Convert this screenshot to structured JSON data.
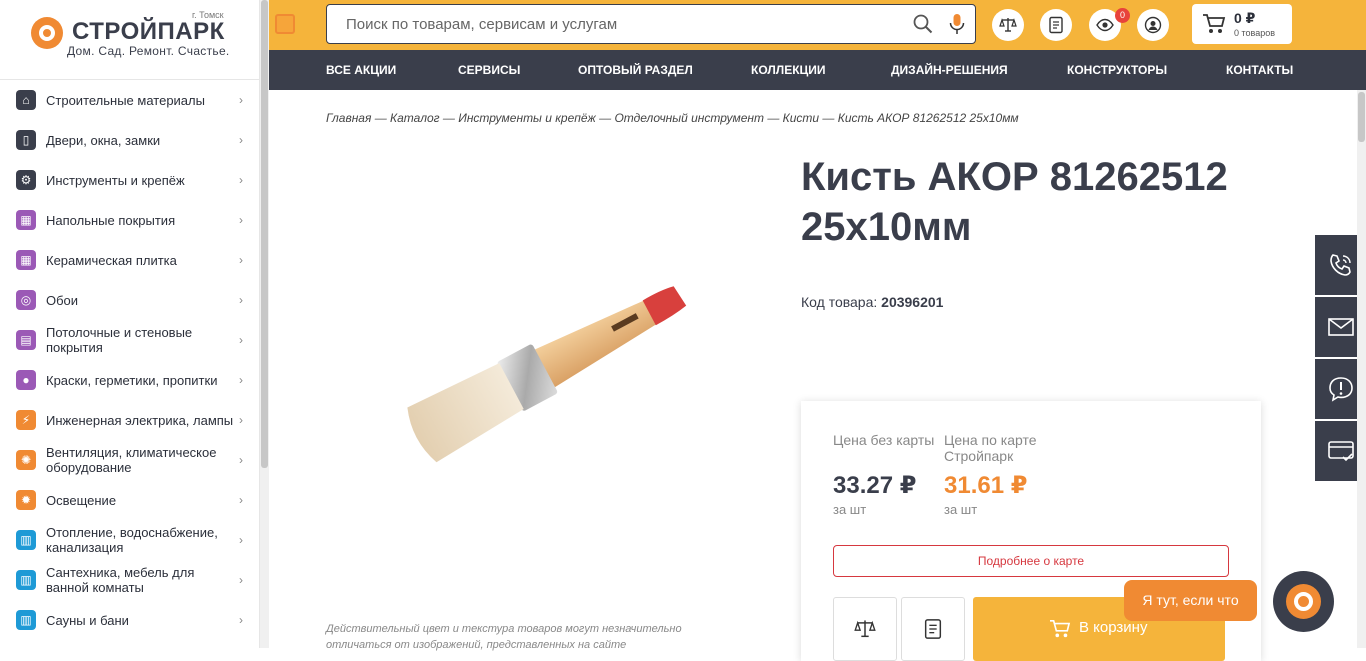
{
  "brand": {
    "name": "СТРОЙПАРК",
    "city": "г. Томск",
    "slogan": "Дом. Сад. Ремонт. Счастье."
  },
  "sidebar": {
    "items": [
      {
        "label": "Строительные материалы",
        "icon": "house-icon",
        "color": "#3a3e4b"
      },
      {
        "label": "Двери, окна, замки",
        "icon": "door-icon",
        "color": "#3a3e4b"
      },
      {
        "label": "Инструменты и крепёж",
        "icon": "gear-icon",
        "color": "#3a3e4b"
      },
      {
        "label": "Напольные покрытия",
        "icon": "floor-icon",
        "color": "#9b59b6"
      },
      {
        "label": "Керамическая плитка",
        "icon": "tile-icon",
        "color": "#9b59b6"
      },
      {
        "label": "Обои",
        "icon": "wallpaper-icon",
        "color": "#9b59b6"
      },
      {
        "label": "Потолочные и стеновые покрытия",
        "icon": "ceiling-icon",
        "color": "#9b59b6"
      },
      {
        "label": "Краски, герметики, пропитки",
        "icon": "paint-drop-icon",
        "color": "#9b59b6"
      },
      {
        "label": "Инженерная электрика, лампы",
        "icon": "lightning-icon",
        "color": "#f08a33"
      },
      {
        "label": "Вентиляция, климатическое оборудование",
        "icon": "fan-icon",
        "color": "#f08a33"
      },
      {
        "label": "Освещение",
        "icon": "sun-icon",
        "color": "#f08a33"
      },
      {
        "label": "Отопление, водоснабжение, канализация",
        "icon": "radiator-icon",
        "color": "#1e9ad6"
      },
      {
        "label": "Сантехника, мебель для ванной комнаты",
        "icon": "bath-icon",
        "color": "#1e9ad6"
      },
      {
        "label": "Сауны и бани",
        "icon": "sauna-icon",
        "color": "#1e9ad6"
      }
    ]
  },
  "search": {
    "placeholder": "Поиск по товарам, сервисам и услугам"
  },
  "header": {
    "notif_count": "0",
    "cart_sum": "0 ₽",
    "cart_count": "0 товаров"
  },
  "nav": [
    "ВСЕ АКЦИИ",
    "СЕРВИСЫ",
    "ОПТОВЫЙ РАЗДЕЛ",
    "КОЛЛЕКЦИИ",
    "ДИЗАЙН-РЕШЕНИЯ",
    "КОНСТРУКТОРЫ",
    "КОНТАКТЫ"
  ],
  "breadcrumbs": "Главная — Каталог — Инструменты и крепёж — Отделочный инструмент — Кисти — Кисть АКОР 81262512 25х10мм",
  "product": {
    "title": "Кисть АКОР 81262512 25х10мм",
    "code_label": "Код товара:",
    "code": "20396201",
    "disclaimer": "Действительный цвет и текстура товаров могут незначительно отличаться от изображений, представленных на сайте"
  },
  "price": {
    "regular_label": "Цена без карты",
    "regular_value": "33.27 ₽",
    "regular_unit": "за шт",
    "card_label": "Цена по карте Стройпарк",
    "card_value": "31.61 ₽",
    "card_unit": "за шт",
    "card_button": "Подробнее о карте",
    "buy_button": "В корзину"
  },
  "chat": {
    "label": "Я тут, если что"
  },
  "colors": {
    "accent": "#f5b43b",
    "orange": "#f08a33",
    "dark": "#3a3e4b",
    "red": "#d6383f"
  }
}
